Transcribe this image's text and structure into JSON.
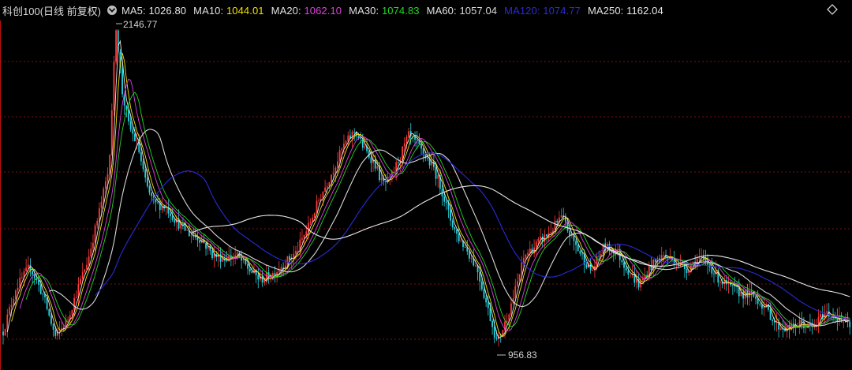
{
  "header": {
    "title": "科创100(日线 前复权)",
    "settings_icon": "diamond-settings-icon",
    "collapse_icon": "chevron-down-icon"
  },
  "moving_averages": [
    {
      "id": "ma5",
      "label": "MA5:",
      "value": "1026.80",
      "color": "#e8e8e8"
    },
    {
      "id": "ma10",
      "label": "MA10:",
      "value": "1044.01",
      "color": "#f2e100"
    },
    {
      "id": "ma20",
      "label": "MA20:",
      "value": "1062.10",
      "color": "#e040e0"
    },
    {
      "id": "ma30",
      "label": "MA30:",
      "value": "1074.83",
      "color": "#20d820"
    },
    {
      "id": "ma60",
      "label": "MA60:",
      "value": "1057.04",
      "color": "#d8d8d8"
    },
    {
      "id": "ma120",
      "label": "MA120:",
      "value": "1074.77",
      "color": "#2a2ad8"
    },
    {
      "id": "ma250",
      "label": "MA250:",
      "value": "1162.04",
      "color": "#e8e8e8"
    }
  ],
  "annotations": {
    "high_label": "2146.77",
    "low_label": "956.83"
  },
  "colors": {
    "up": "#ff3b3b",
    "down": "#29d4e0",
    "grid": "#7a1010",
    "background": "#000000"
  }
}
